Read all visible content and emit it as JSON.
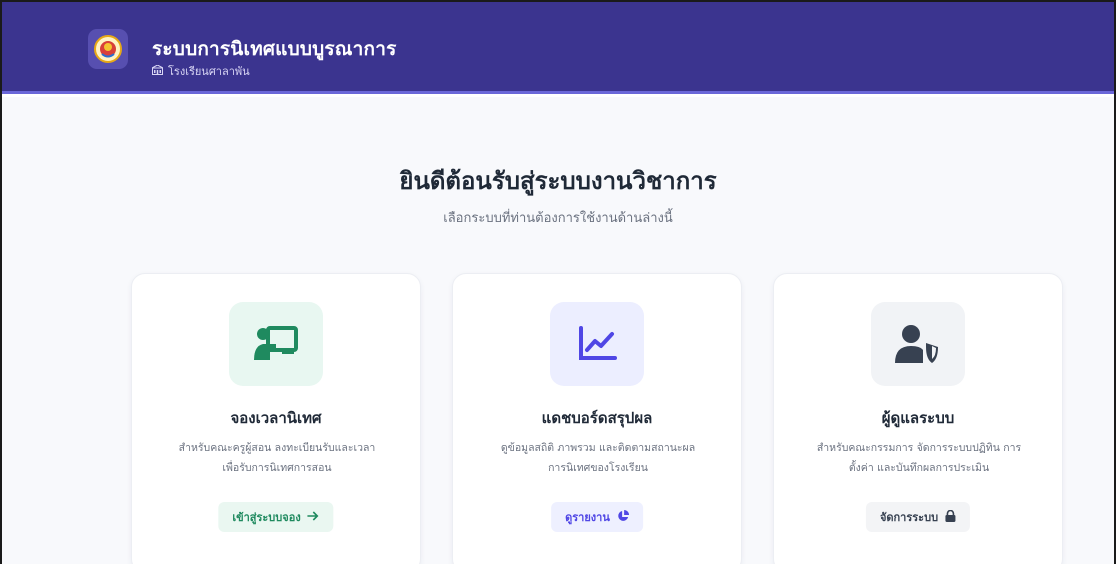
{
  "header": {
    "title": "ระบบการนิเทศแบบบูรณาการ",
    "school": "โรงเรียนศาลาพัน",
    "logo_icon": "school-seal-icon",
    "school_icon": "building-icon"
  },
  "welcome": {
    "title": "ยินดีต้อนรับสู่ระบบงานวิชาการ",
    "subtitle": "เลือกระบบที่ท่านต้องการใช้งานด้านล่างนี้"
  },
  "cards": [
    {
      "icon": "teacher-presentation-icon",
      "title": "จองเวลานิเทศ",
      "desc_line1": "สำหรับคณะครูผู้สอน ลงทะเบียนรับและเวลา",
      "desc_line2": "เพื่อรับการนิเทศการสอน",
      "button": "เข้าสู่ระบบจอง",
      "button_icon": "arrow-right-icon",
      "accent": "#1f8a5f",
      "icon_bg": "#e8f7f1",
      "button_bg": "#eaf7f1"
    },
    {
      "icon": "line-chart-icon",
      "title": "แดชบอร์ดสรุปผล",
      "desc_line1": "ดูข้อมูลสถิติ ภาพรวม และติดตามสถานะผล",
      "desc_line2": "การนิเทศของโรงเรียน",
      "button": "ดูรายงาน",
      "button_icon": "pie-chart-icon",
      "accent": "#4f46e5",
      "icon_bg": "#eceeff",
      "button_bg": "#eef0ff"
    },
    {
      "icon": "user-shield-icon",
      "title": "ผู้ดูแลระบบ",
      "desc_line1": "สำหรับคณะกรรมการ จัดการระบบปฏิทิน การ",
      "desc_line2": "ตั้งค่า และบันทึกผลการประเมิน",
      "button": "จัดการระบบ",
      "button_icon": "lock-icon",
      "accent": "#374151",
      "icon_bg": "#f1f3f6",
      "button_bg": "#f3f4f6"
    }
  ]
}
